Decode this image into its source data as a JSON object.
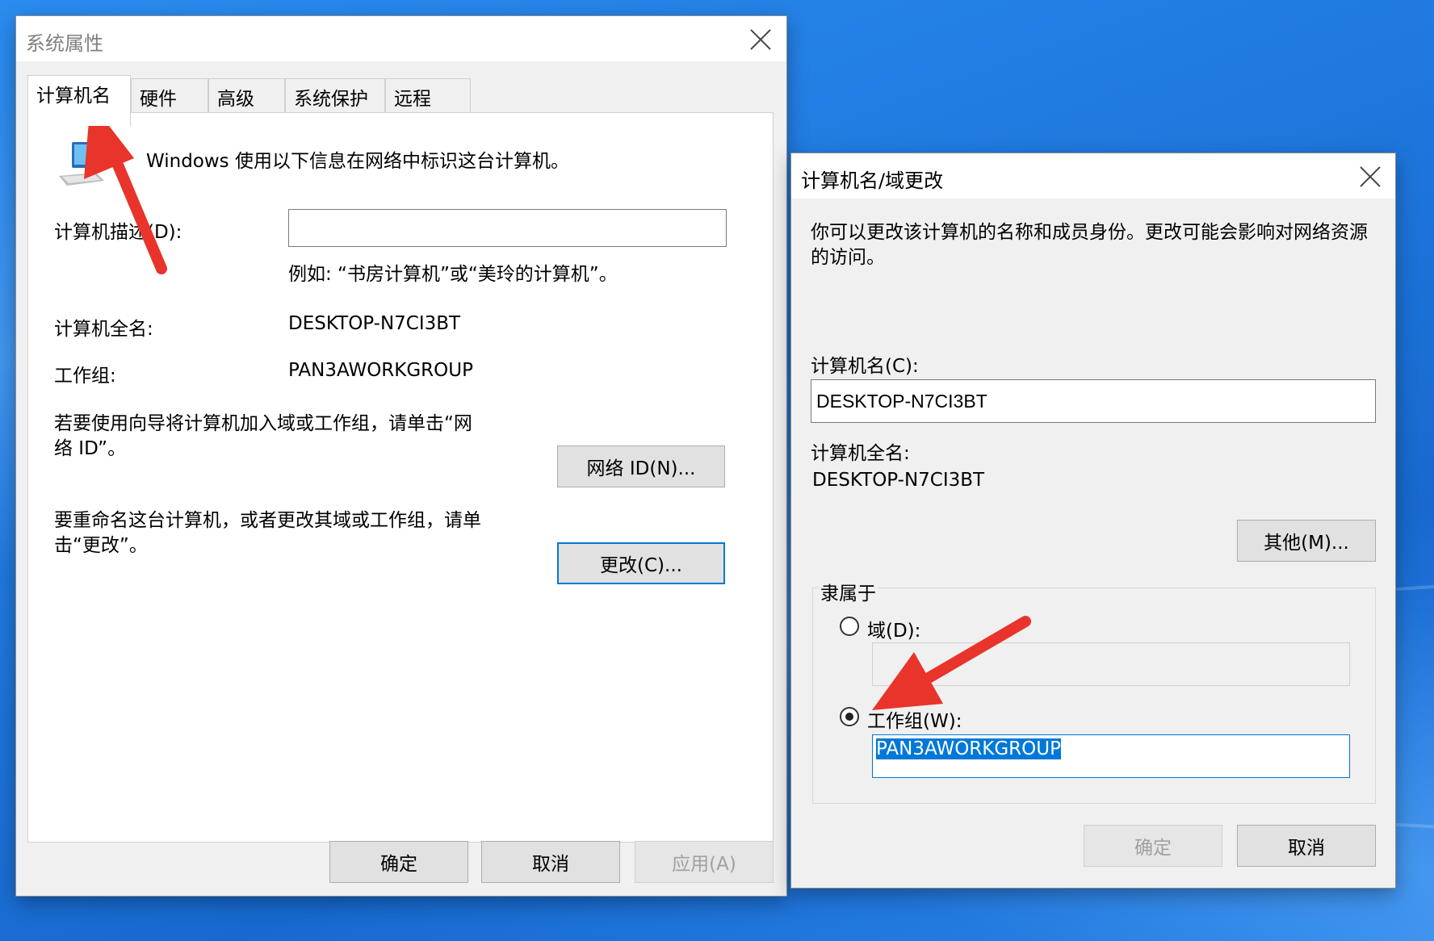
{
  "system_properties": {
    "title": "系统属性",
    "tabs": [
      "计算机名",
      "硬件",
      "高级",
      "系统保护",
      "远程"
    ],
    "intro": "Windows 使用以下信息在网络中标识这台计算机。",
    "description_label": "计算机描述(D):",
    "description_value": "",
    "example": "例如: “书房计算机”或“美玲的计算机”。",
    "full_name_label": "计算机全名:",
    "full_name_value": "DESKTOP-N7CI3BT",
    "workgroup_label": "工作组:",
    "workgroup_value": "PAN3AWORKGROUP",
    "network_id_text": "若要使用向导将计算机加入域或工作组，请单击“网络 ID”。",
    "network_id_button": "网络 ID(N)...",
    "rename_text": "要重命名这台计算机，或者更改其域或工作组，请单击“更改”。",
    "change_button": "更改(C)...",
    "ok_button": "确定",
    "cancel_button": "取消",
    "apply_button": "应用(A)"
  },
  "change_dialog": {
    "title": "计算机名/域更改",
    "intro": "你可以更改该计算机的名称和成员身份。更改可能会影响对网络资源的访问。",
    "computer_name_label": "计算机名(C):",
    "computer_name_value": "DESKTOP-N7CI3BT",
    "full_name_label": "计算机全名:",
    "full_name_value": "DESKTOP-N7CI3BT",
    "more_button": "其他(M)...",
    "member_of_label": "隶属于",
    "domain_label": "域(D):",
    "domain_value": "",
    "workgroup_label": "工作组(W):",
    "workgroup_value": "PAN3AWORKGROUP",
    "ok_button": "确定",
    "cancel_button": "取消"
  },
  "colors": {
    "accent": "#0078d7",
    "arrow": "#e8342a"
  }
}
